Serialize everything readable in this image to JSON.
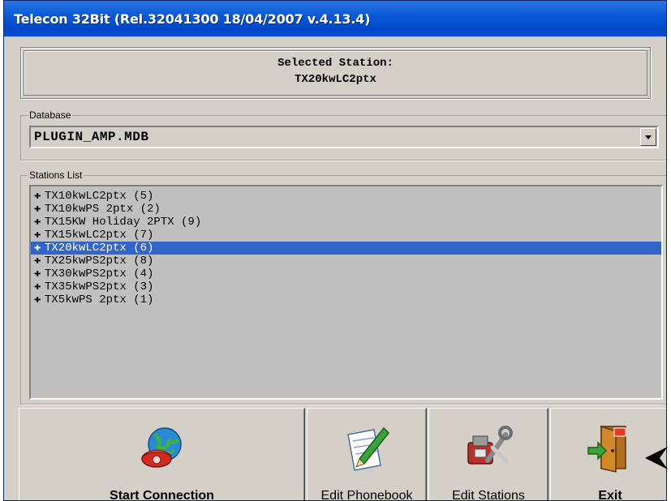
{
  "window": {
    "title": "Telecon 32Bit (Rel.32041300 18/04/2007 v.4.13.4)"
  },
  "selected_station": {
    "caption": "Selected Station:",
    "value": "TX20kwLC2ptx"
  },
  "database": {
    "label": "Database",
    "value": "PLUGIN_AMP.MDB"
  },
  "stations": {
    "label": "Stations List",
    "items": [
      "TX10kwLC2ptx (5)",
      "TX10kwPS 2ptx (2)",
      "TX15KW Holiday 2PTX (9)",
      "TX15kwLC2ptx (7)",
      "TX20kwLC2ptx (6)",
      "TX25kwPS2ptx (8)",
      "TX30kwPS2ptx (4)",
      "TX35kwPS2ptx (3)",
      "TX5kwPS 2ptx (1)"
    ],
    "selected": "TX20kwLC2ptx (6)"
  },
  "buttons": {
    "start": "Start Connection",
    "phonebook": "Edit Phonebook",
    "stations": "Edit Stations",
    "exit": "Exit"
  },
  "icons": {
    "start": "phone-globe-icon",
    "phonebook": "pen-paper-icon",
    "stations": "tools-icon",
    "exit": "exit-door-icon",
    "list_item": "plus-icon"
  },
  "colors": {
    "title_bar": "#0a5ad8",
    "selection": "#3165c7",
    "window_face": "#d4d0c8"
  }
}
